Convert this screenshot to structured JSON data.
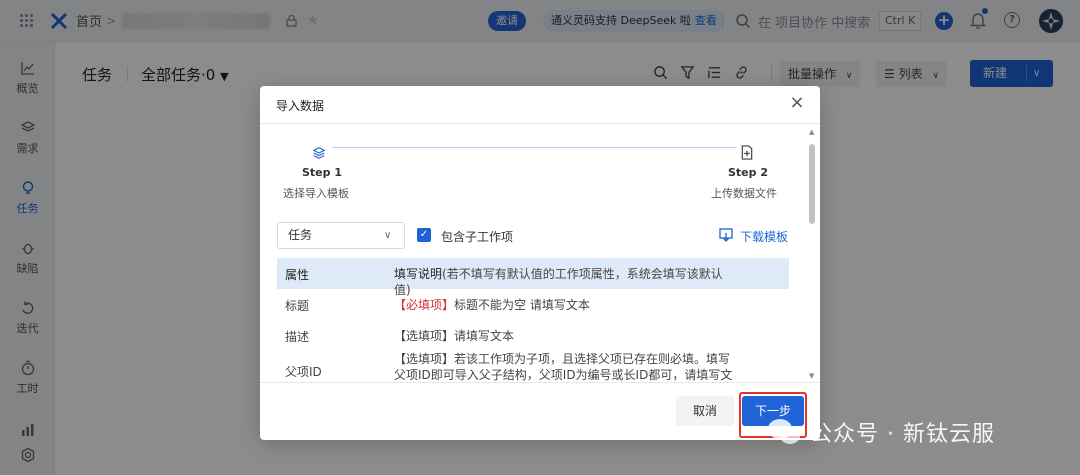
{
  "topbar": {
    "home": "首页",
    "crumb_sep": ">",
    "invite": "邀请",
    "promo": "通义灵码支持 DeepSeek 啦",
    "promo_link": "查看",
    "search_placeholder": "在 项目协作 中搜索",
    "shortcut": "Ctrl K",
    "plus": "+",
    "help": "?"
  },
  "sidebar": {
    "items": [
      {
        "label": "概览",
        "icon": "chart-line-icon"
      },
      {
        "label": "需求",
        "icon": "layers-icon"
      },
      {
        "label": "任务",
        "icon": "bulb-icon"
      },
      {
        "label": "缺陷",
        "icon": "bug-icon"
      },
      {
        "label": "迭代",
        "icon": "cycle-icon"
      },
      {
        "label": "工时",
        "icon": "timer-icon"
      }
    ]
  },
  "toolbar": {
    "title": "任务",
    "filter": "全部任务·0",
    "batch": "批量操作",
    "view": "列表",
    "new": "新建"
  },
  "modal": {
    "title": "导入数据",
    "close": "×",
    "step1": {
      "label": "Step 1",
      "sub": "选择导入模板"
    },
    "step2": {
      "label": "Step 2",
      "sub": "上传数据文件"
    },
    "type_select": "任务",
    "checkbox_label": "包含子工作项",
    "download": "下载模板",
    "table": {
      "header": {
        "a": "属性",
        "b_bold": "填写说明",
        "b_rest": "(若不填写有默认值的工作项属性，系统会填写该默认值)"
      },
      "rows": [
        {
          "a": "标题",
          "tag": "【必填项】",
          "text": "标题不能为空 请填写文本"
        },
        {
          "a": "描述",
          "tag": "【选填项】",
          "text": "请填写文本"
        },
        {
          "a": "父项ID",
          "tag": "【选填项】",
          "text": "若该工作项为子项，且选择父项已存在则必填。填写父项ID即可导入父子结构，父项ID为编号或长ID都可，请填写文本"
        }
      ]
    },
    "cancel": "取消",
    "next": "下一步"
  },
  "watermark": "公众号 · 新钛云服",
  "colors": {
    "accent": "#1f63d6",
    "required": "#d0342c",
    "highlight": "#e0342c"
  }
}
